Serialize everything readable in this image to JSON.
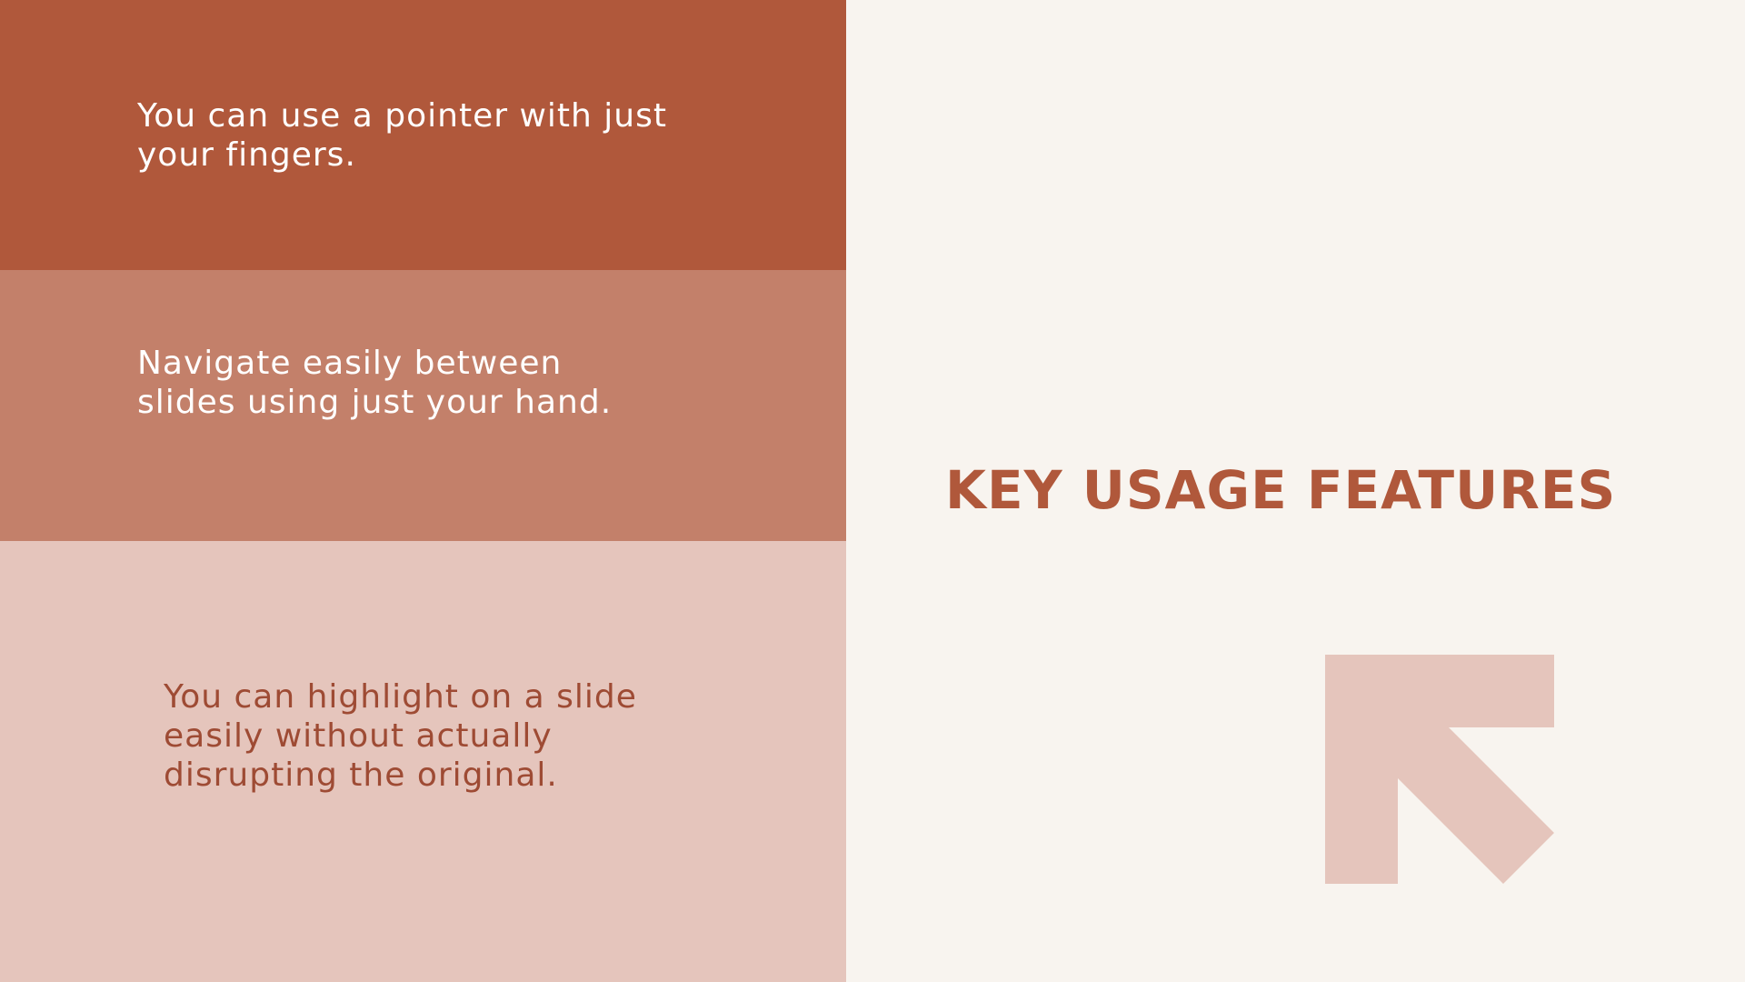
{
  "panels": [
    {
      "text": "You can use a pointer with just your fingers."
    },
    {
      "text": "Navigate easily between slides using just your hand."
    },
    {
      "text": "You can highlight on a slide easily without actually disrupting the original."
    }
  ],
  "heading": "KEY USAGE FEATURES",
  "icons": {
    "arrow": "arrow-up-left-icon"
  },
  "colors": {
    "background": "#F8F4EF",
    "panel_dark": "#B0583B",
    "panel_medium": "#C3806A",
    "panel_light": "#E5C5BC",
    "accent_text": "#B0583B",
    "panel_light_text": "#9E4B34"
  }
}
